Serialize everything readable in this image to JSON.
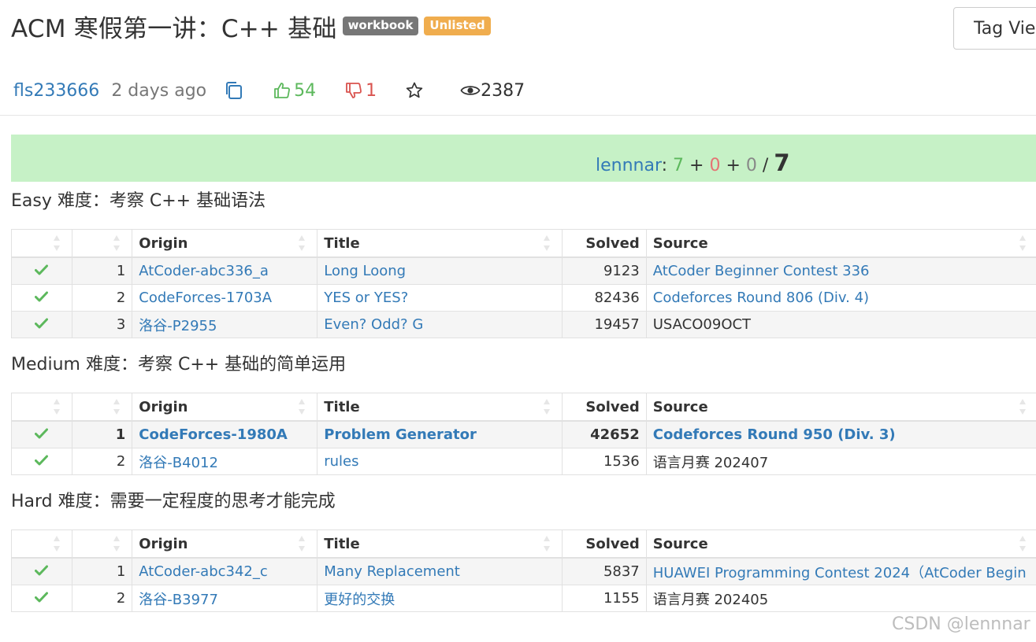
{
  "header": {
    "title": "ACM 寒假第一讲：C++ 基础",
    "badges": [
      "workbook",
      "Unlisted"
    ],
    "tag_view_label": "Tag View"
  },
  "meta": {
    "author": "fls233666",
    "time": "2 days ago",
    "upvotes": "54",
    "downvotes": "1",
    "views": "2387"
  },
  "score": {
    "user": "lennnar",
    "colon": ":",
    "solved": "7",
    "plus1": "+",
    "wrong": "0",
    "plus2": "+",
    "other": "0",
    "slash": "/",
    "total": "7"
  },
  "columns": [
    "",
    "",
    "Origin",
    "Title",
    "Solved",
    "Source"
  ],
  "sections": [
    {
      "title": "Easy 难度：考察 C++ 基础语法",
      "rows": [
        {
          "idx": "1",
          "origin": "AtCoder-abc336_a",
          "title": "Long Loong",
          "solved": "9123",
          "source": "AtCoder Beginner Contest 336",
          "source_link": true
        },
        {
          "idx": "2",
          "origin": "CodeForces-1703A",
          "title": "YES or YES?",
          "solved": "82436",
          "source": "Codeforces Round 806 (Div. 4)",
          "source_link": true
        },
        {
          "idx": "3",
          "origin": "洛谷-P2955",
          "title": "Even? Odd? G",
          "solved": "19457",
          "source": "USACO09OCT",
          "source_link": false
        }
      ]
    },
    {
      "title": "Medium 难度：考察 C++ 基础的简单运用",
      "rows": [
        {
          "idx": "1",
          "origin": "CodeForces-1980A",
          "title": "Problem Generator",
          "solved": "42652",
          "source": "Codeforces Round 950 (Div. 3)",
          "source_link": true
        },
        {
          "idx": "2",
          "origin": "洛谷-B4012",
          "title": "rules",
          "solved": "1536",
          "source": "语言月赛 202407",
          "source_link": false
        }
      ]
    },
    {
      "title": "Hard 难度：需要一定程度的思考才能完成",
      "rows": [
        {
          "idx": "1",
          "origin": "AtCoder-abc342_c",
          "title": "Many Replacement",
          "solved": "5837",
          "source": "HUAWEI Programming Contest 2024（AtCoder Begin",
          "source_link": true
        },
        {
          "idx": "2",
          "origin": "洛谷-B3977",
          "title": "更好的交换",
          "solved": "1155",
          "source": "语言月赛 202405",
          "source_link": false
        }
      ]
    }
  ],
  "watermark": "CSDN @lennnar",
  "colors": {
    "accent": "#337ab7",
    "success": "#5cb85c",
    "danger": "#d9534f",
    "score_bg": "#c6f1c6"
  }
}
